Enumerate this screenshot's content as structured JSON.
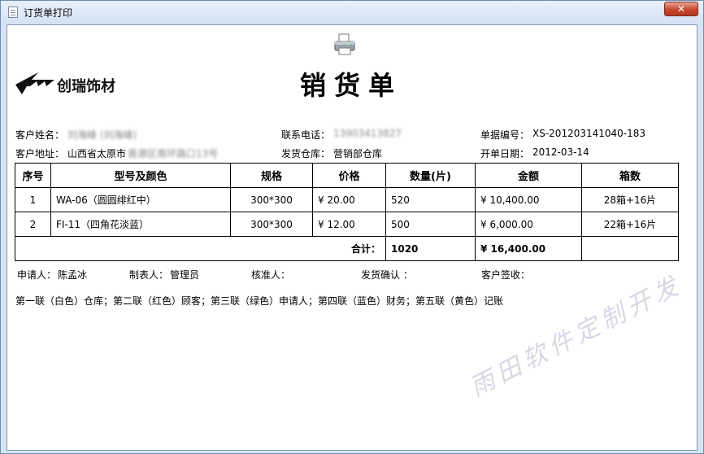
{
  "window": {
    "title": "订货单打印",
    "close_glyph": "✕"
  },
  "doc": {
    "company": "创瑞饰材",
    "title": "销货单"
  },
  "info": {
    "customer_name_label": "客户姓名：",
    "customer_name": "刘海峰 (刘海峰)",
    "phone_label": "联系电话：",
    "phone": "13903413827",
    "doc_no_label": "单据编号：",
    "doc_no": "XS-201203141040-183",
    "address_label": "客户地址：",
    "address_city": "山西省太原市",
    "address_rest": "晋源区南环路口13号",
    "warehouse_label": "发货仓库：",
    "warehouse": "营销部仓库",
    "date_label": "开单日期：",
    "date": "2012-03-14"
  },
  "table": {
    "headers": [
      "序号",
      "型号及颜色",
      "规格",
      "价格",
      "数量(片)",
      "金额",
      "箱数"
    ],
    "rows": [
      {
        "no": "1",
        "model": "WA-06（圆圆绯红中）",
        "spec": "300*300",
        "price": "¥ 20.00",
        "qty": "520",
        "amount": "¥ 10,400.00",
        "boxes": "28箱+16片"
      },
      {
        "no": "2",
        "model": "FI-11（四角花淡蓝）",
        "spec": "300*300",
        "price": "¥ 12.00",
        "qty": "500",
        "amount": "¥ 6,000.00",
        "boxes": "22箱+16片"
      }
    ],
    "total_label": "合计：",
    "total_qty": "1020",
    "total_amount": "¥ 16,400.00"
  },
  "footer": {
    "applicant_label": "申请人：",
    "applicant": "陈孟冰",
    "maker_label": "制表人：",
    "maker": "管理员",
    "approver_label": "核准人：",
    "ship_confirm_label": "发货确认 ：",
    "sign_label": "客户签收：",
    "copies_note": "第一联（白色）仓库；第二联（红色）顾客；第三联（绿色）申请人；第四联（蓝色）财务；第五联（黄色）记账"
  },
  "watermark": "雨田软件定制开发",
  "icons": {
    "printer": "printer-icon",
    "logo": "logo-mark-icon"
  }
}
